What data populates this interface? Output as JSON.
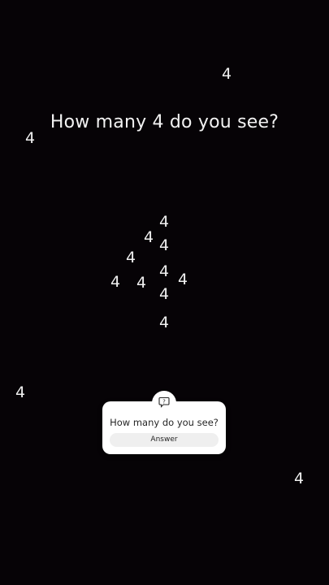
{
  "headline": "How many 4 do you see?",
  "digit": "4",
  "card": {
    "question": "How many do you see?",
    "answer_label": "Answer",
    "icon": "question-speech-bubble-icon"
  }
}
